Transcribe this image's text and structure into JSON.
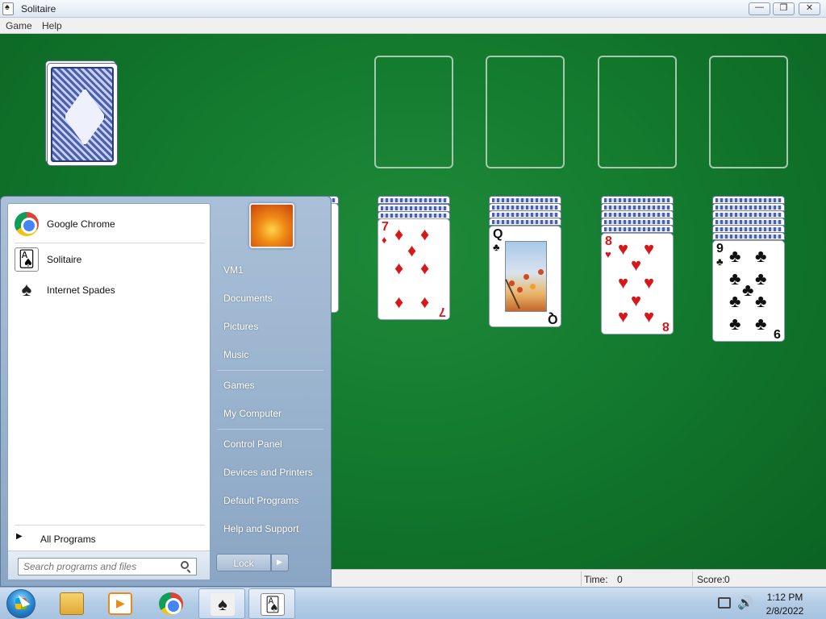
{
  "window": {
    "title": "Solitaire",
    "controls": {
      "minimize": "—",
      "maximize": "❐",
      "close": "✕"
    }
  },
  "menubar": {
    "game": "Game",
    "help": "Help"
  },
  "board": {
    "felt_color": "#137a2e",
    "foundations": 4,
    "tableau": [
      {
        "rank": "7",
        "suit": "♦",
        "color": "red"
      },
      {
        "rank": "Q",
        "suit": "♣",
        "color": "black"
      },
      {
        "rank": "8",
        "suit": "♥",
        "color": "red"
      },
      {
        "rank": "9",
        "suit": "♣",
        "color": "black"
      }
    ]
  },
  "statusbar": {
    "time_label": "Time:",
    "time_value": "0",
    "score_label": "Score:",
    "score_value": "0"
  },
  "start_menu": {
    "pinned": [
      {
        "label": "Google Chrome",
        "icon": "chrome-icon"
      },
      {
        "label": "Solitaire",
        "icon": "solitaire-icon"
      },
      {
        "label": "Internet Spades",
        "icon": "spades-icon"
      }
    ],
    "all_programs": "All Programs",
    "search_placeholder": "Search programs and files",
    "right_items": [
      "VM1",
      "Documents",
      "Pictures",
      "Music",
      "Games",
      "My Computer",
      "Control Panel",
      "Devices and Printers",
      "Default Programs",
      "Help and Support"
    ],
    "lock_label": "Lock"
  },
  "taskbar": {
    "apps": [
      "explorer-icon",
      "media-player-icon",
      "chrome-icon",
      "spades-icon",
      "solitaire-icon"
    ],
    "clock_time": "1:12 PM",
    "clock_date": "2/8/2022"
  }
}
